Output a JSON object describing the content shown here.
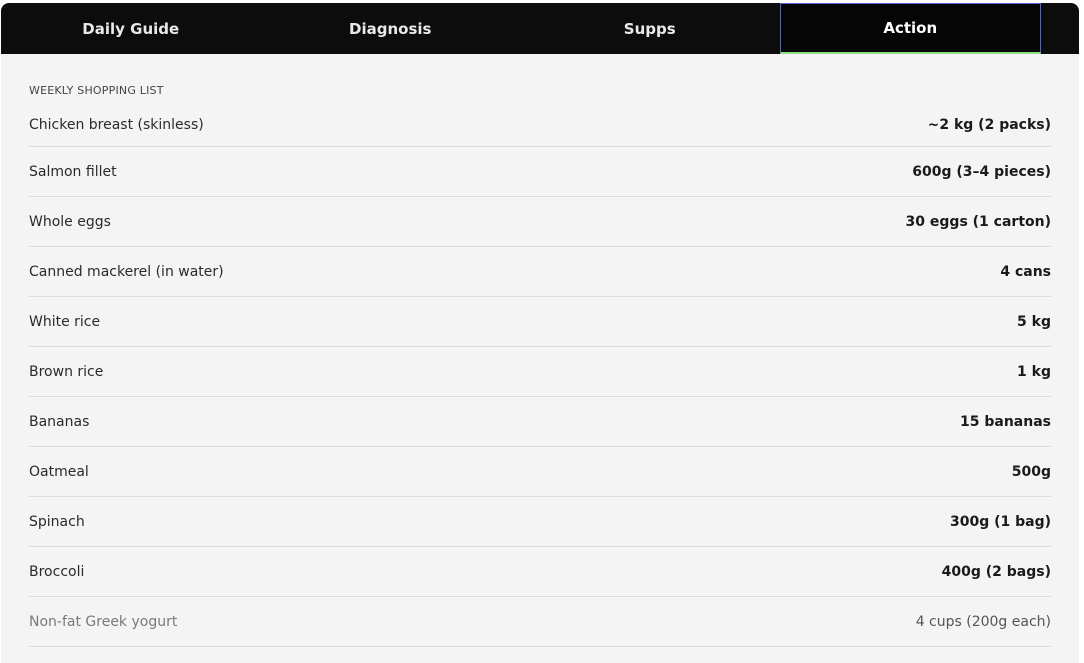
{
  "tabs": [
    {
      "label": "Daily Guide"
    },
    {
      "label": "Diagnosis"
    },
    {
      "label": "Supps"
    },
    {
      "label": "Action"
    }
  ],
  "active_tab": "Action",
  "section": {
    "label": "WEEKLY SHOPPING LIST"
  },
  "items": [
    {
      "name": "Chicken breast (skinless)",
      "qty": "~2 kg (2 packs)"
    },
    {
      "name": "Salmon fillet",
      "qty": "600g (3–4 pieces)"
    },
    {
      "name": "Whole eggs",
      "qty": "30 eggs (1 carton)"
    },
    {
      "name": "Canned mackerel (in water)",
      "qty": "4 cans"
    },
    {
      "name": "White rice",
      "qty": "5 kg"
    },
    {
      "name": "Brown rice",
      "qty": "1 kg"
    },
    {
      "name": "Bananas",
      "qty": "15 bananas"
    },
    {
      "name": "Oatmeal",
      "qty": "500g"
    },
    {
      "name": "Spinach",
      "qty": "300g (1 bag)"
    },
    {
      "name": "Broccoli",
      "qty": "400g (2 bags)"
    },
    {
      "name": "Non-fat Greek yogurt",
      "qty": "4 cups (200g each)"
    }
  ]
}
